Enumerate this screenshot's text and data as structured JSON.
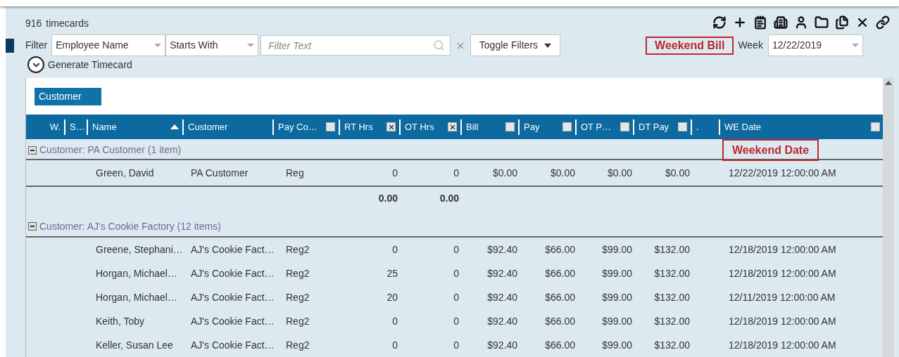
{
  "header": {
    "count": "916",
    "count_label": "timecards"
  },
  "filter": {
    "label": "Filter",
    "field": "Employee Name",
    "operator": "Starts With",
    "placeholder": "Filter Text",
    "clear": "×",
    "toggle": "Toggle Filters"
  },
  "week": {
    "annotation": "Weekend Bill",
    "label": "Week",
    "value": "12/22/2019"
  },
  "generate": {
    "label": "Generate Timecard"
  },
  "group_panel": {
    "chips": [
      "Customer"
    ]
  },
  "columns": [
    {
      "label": "W."
    },
    {
      "label": "S…"
    },
    {
      "label": "Name",
      "sorted": true
    },
    {
      "label": "Customer"
    },
    {
      "label": "Pay Co…",
      "checked": false
    },
    {
      "label": "RT Hrs",
      "checked": true
    },
    {
      "label": "OT Hrs",
      "checked": true
    },
    {
      "label": "Bill",
      "checked": false
    },
    {
      "label": "Pay",
      "checked": false
    },
    {
      "label": "OT P…",
      "checked": false
    },
    {
      "label": "DT Pay",
      "checked": false
    },
    {
      "label": "."
    },
    {
      "label": "WE Date",
      "checked": false
    }
  ],
  "groups": [
    {
      "title": "Customer: PA Customer (1 item)",
      "expanded": true,
      "annotation": "Weekend Date",
      "rows": [
        {
          "name": "Green, David",
          "customer": "PA Customer",
          "pay_code": "Reg",
          "rt_hrs": "0",
          "ot_hrs": "0",
          "bill": "$0.00",
          "pay": "$0.00",
          "ot_pay": "$0.00",
          "dt_pay": "$0.00",
          "we_date": "12/22/2019 12:00:00 AM"
        }
      ],
      "totals": {
        "rt_hrs": "0.00",
        "ot_hrs": "0.00"
      }
    },
    {
      "title": "Customer: AJ's Cookie Factory (12 items)",
      "expanded": true,
      "rows": [
        {
          "name": "Greene, Stephani…",
          "customer": "AJ's Cookie Fact…",
          "pay_code": "Reg2",
          "rt_hrs": "0",
          "ot_hrs": "0",
          "bill": "$92.40",
          "pay": "$66.00",
          "ot_pay": "$99.00",
          "dt_pay": "$132.00",
          "we_date": "12/18/2019 12:00:00 AM"
        },
        {
          "name": "Horgan, Michael…",
          "customer": "AJ's Cookie Fact…",
          "pay_code": "Reg2",
          "rt_hrs": "25",
          "ot_hrs": "0",
          "bill": "$92.40",
          "pay": "$66.00",
          "ot_pay": "$99.00",
          "dt_pay": "$132.00",
          "we_date": "12/18/2019 12:00:00 AM"
        },
        {
          "name": "Horgan, Michael…",
          "customer": "AJ's Cookie Fact…",
          "pay_code": "Reg2",
          "rt_hrs": "20",
          "ot_hrs": "0",
          "bill": "$92.40",
          "pay": "$66.00",
          "ot_pay": "$99.00",
          "dt_pay": "$132.00",
          "we_date": "12/11/2019 12:00:00 AM"
        },
        {
          "name": "Keith, Toby",
          "customer": "AJ's Cookie Fact…",
          "pay_code": "Reg2",
          "rt_hrs": "0",
          "ot_hrs": "0",
          "bill": "$92.40",
          "pay": "$66.00",
          "ot_pay": "$99.00",
          "dt_pay": "$132.00",
          "we_date": "12/18/2019 12:00:00 AM"
        },
        {
          "name": "Keller, Susan Lee",
          "customer": "AJ's Cookie Fact…",
          "pay_code": "Reg2",
          "rt_hrs": "0",
          "ot_hrs": "0",
          "bill": "$92.40",
          "pay": "$66.00",
          "ot_pay": "$99.00",
          "dt_pay": "$132.00",
          "we_date": "12/18/2019 12:00:00 AM"
        }
      ]
    }
  ]
}
